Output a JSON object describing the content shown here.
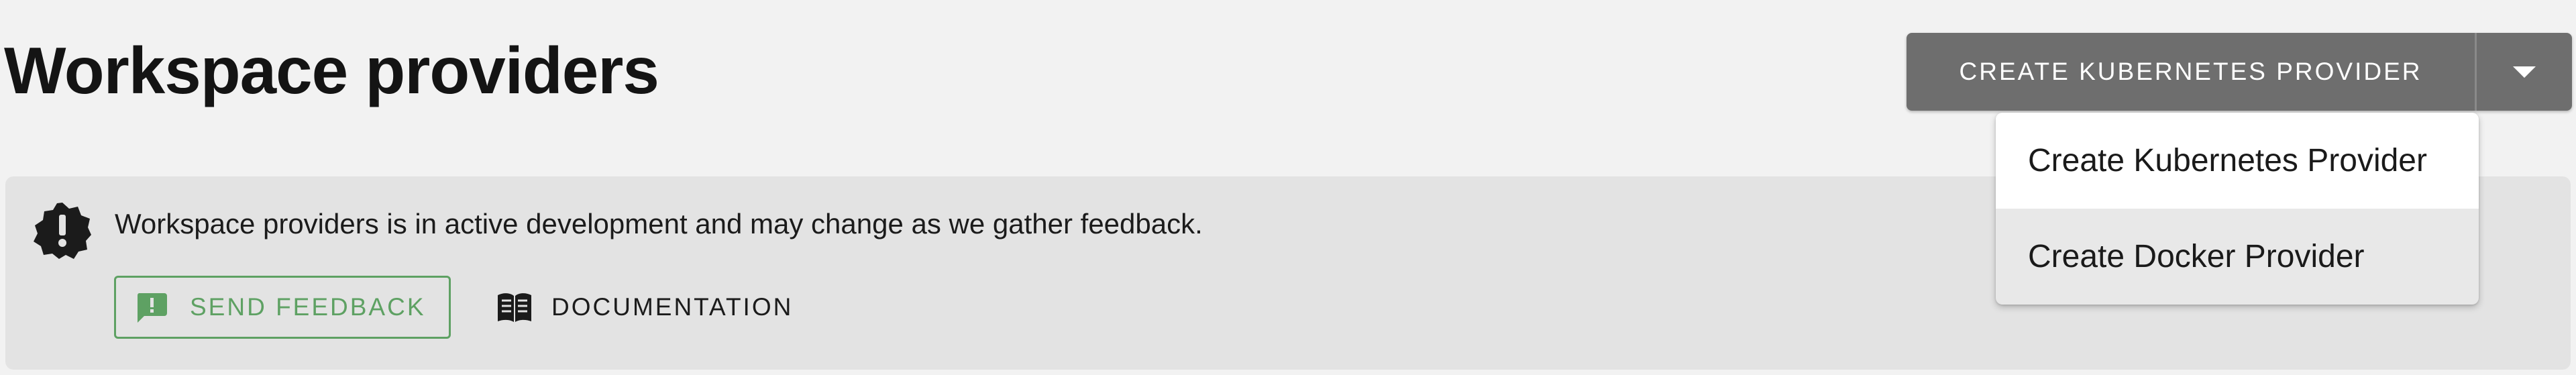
{
  "header": {
    "title": "Workspace providers"
  },
  "create_button": {
    "label": "CREATE KUBERNETES PROVIDER",
    "toggle_icon": "caret-down-icon"
  },
  "dropdown": {
    "items": [
      {
        "label": "Create Kubernetes Provider",
        "highlighted": true
      },
      {
        "label": "Create Docker Provider",
        "highlighted": false
      }
    ]
  },
  "banner": {
    "icon": "alert-badge-icon",
    "message": "Workspace providers is in active development and may change as we gather feedback.",
    "feedback_button": {
      "label": "SEND FEEDBACK",
      "icon": "feedback-icon"
    },
    "docs_link": {
      "label": "DOCUMENTATION",
      "icon": "book-icon"
    }
  },
  "colors": {
    "background": "#f2f2f2",
    "banner_background": "#e3e3e3",
    "primary_button": "#6e6e6e",
    "feedback_green": "#5ea163",
    "menu_background": "#e8e8e8",
    "menu_highlight": "#ffffff"
  }
}
